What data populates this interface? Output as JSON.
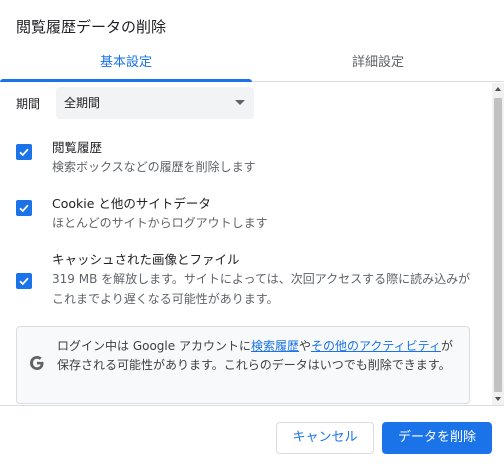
{
  "dialog": {
    "title": "閲覧履歴データの削除"
  },
  "tabs": [
    {
      "label": "基本設定",
      "active": true
    },
    {
      "label": "詳細設定",
      "active": false
    }
  ],
  "period": {
    "label": "期間",
    "selected": "全期間"
  },
  "options": [
    {
      "title": "閲覧履歴",
      "description": "検索ボックスなどの履歴を削除します",
      "checked": true
    },
    {
      "title": "Cookie と他のサイトデータ",
      "description": "ほとんどのサイトからログアウトします",
      "checked": true
    },
    {
      "title": "キャッシュされた画像とファイル",
      "description": "319 MB を解放します。サイトによっては、次回アクセスする際に読み込みがこれまでより遅くなる可能性があります。",
      "checked": true
    }
  ],
  "info": {
    "text_1": "ログイン中は Google アカウントに",
    "link_1": "検索履歴",
    "text_2": "や",
    "link_2": "その他のアクティビティ",
    "text_3": "が保存される可能性があります。これらのデータはいつでも削除できます。",
    "icon": "google-g-icon"
  },
  "buttons": {
    "cancel": "キャンセル",
    "delete": "データを削除"
  },
  "colors": {
    "accent": "#1a73e8",
    "text": "#202124",
    "secondary_text": "#5f6368",
    "divider": "#dadce0"
  }
}
